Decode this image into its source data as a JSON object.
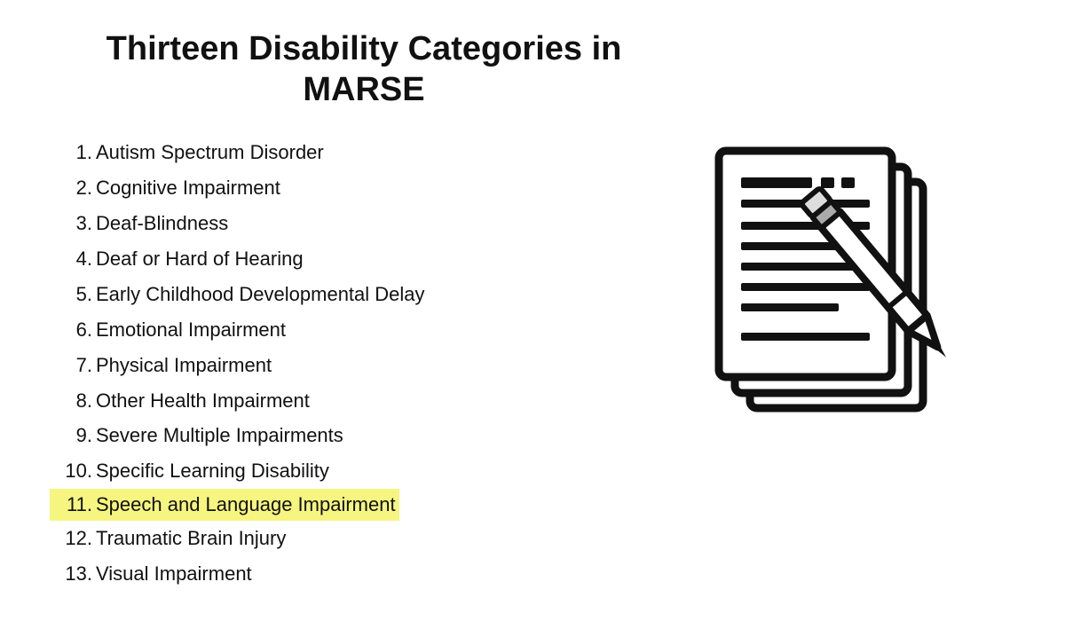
{
  "page": {
    "title": "Thirteen Disability Categories in MARSE",
    "background_color": "#ffffff"
  },
  "list": {
    "items": [
      {
        "number": "1.",
        "text": "Autism Spectrum Disorder",
        "highlighted": false
      },
      {
        "number": "2.",
        "text": "Cognitive Impairment",
        "highlighted": false
      },
      {
        "number": "3.",
        "text": "Deaf-Blindness",
        "highlighted": false
      },
      {
        "number": "4.",
        "text": "Deaf or Hard of Hearing",
        "highlighted": false
      },
      {
        "number": "5.",
        "text": "Early Childhood Developmental Delay",
        "highlighted": false
      },
      {
        "number": "6.",
        "text": "Emotional Impairment",
        "highlighted": false
      },
      {
        "number": "7.",
        "text": "Physical Impairment",
        "highlighted": false
      },
      {
        "number": "8.",
        "text": "Other Health Impairment",
        "highlighted": false
      },
      {
        "number": "9.",
        "text": "Severe Multiple Impairments",
        "highlighted": false
      },
      {
        "number": "10.",
        "text": "Specific Learning Disability",
        "highlighted": false
      },
      {
        "number": "11.",
        "text": "Speech and Language Impairment",
        "highlighted": true
      },
      {
        "number": "12.",
        "text": "Traumatic Brain Injury",
        "highlighted": false
      },
      {
        "number": "13.",
        "text": "Visual Impairment",
        "highlighted": false
      }
    ]
  }
}
